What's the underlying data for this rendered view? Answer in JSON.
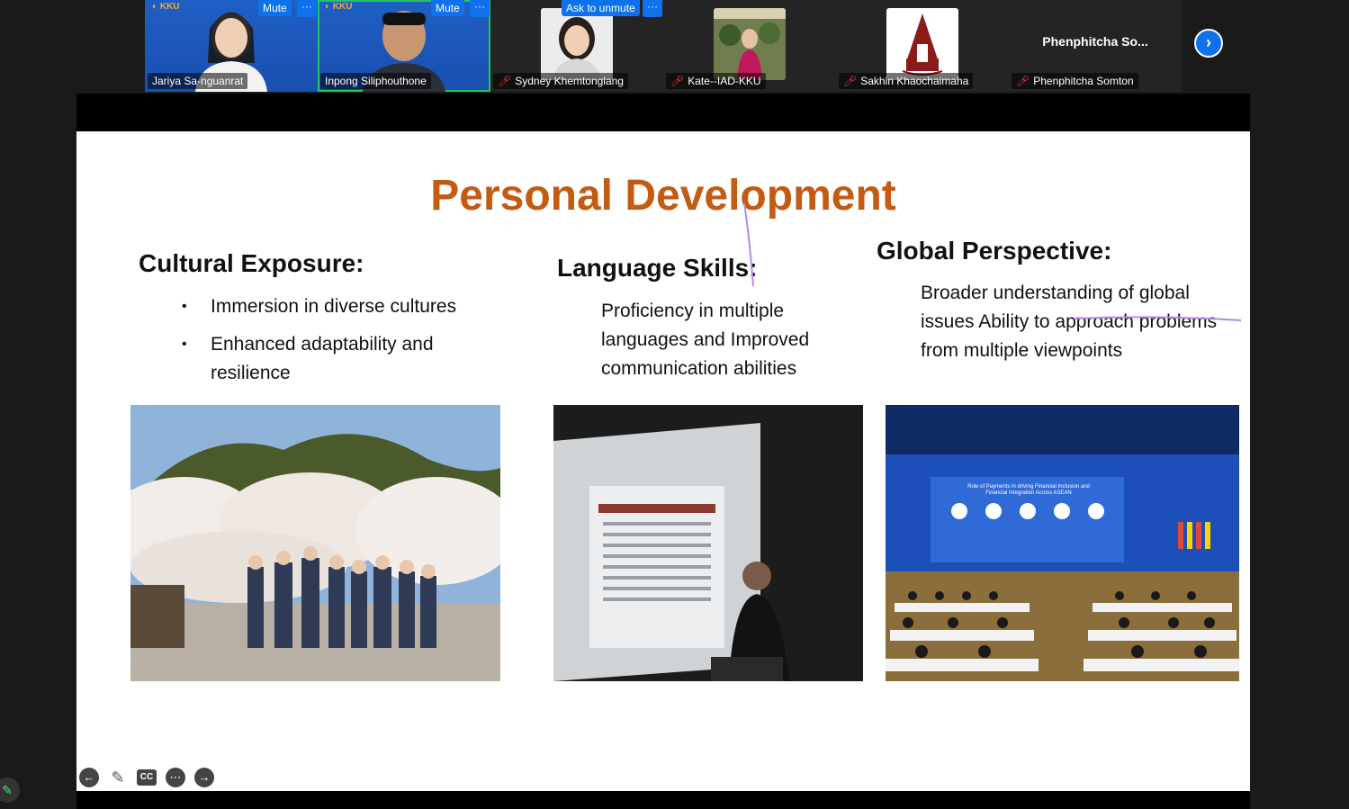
{
  "participants": [
    {
      "name": "Jariya Sa-nguanrat",
      "badge": "Mute",
      "menu": "···",
      "video": true
    },
    {
      "name": "Inpong Siliphouthone",
      "badge": "Mute",
      "menu": "···",
      "video": true
    },
    {
      "name": "Sydney Khemtonglang",
      "badge": "Ask to unmute",
      "menu": "···",
      "muted": true
    },
    {
      "name": "Kate--IAD-KKU",
      "muted": true
    },
    {
      "name": "Sakhin Khaochaimaha",
      "muted": true
    },
    {
      "name": "Phenphitcha Somton",
      "display_name": "Phenphitcha  So...",
      "muted": true
    }
  ],
  "next_icon": "chevron-right-icon",
  "slide": {
    "title": "Personal Development",
    "columns": [
      {
        "heading": "Cultural Exposure:",
        "bullets": [
          "Immersion in diverse cultures",
          "Enhanced adaptability and resilience"
        ]
      },
      {
        "heading": "Language Skills:",
        "text": "Proficiency in multiple languages and Improved communication abilities"
      },
      {
        "heading": "Global Perspective:",
        "text": "Broader understanding of global issues Ability to approach problems from multiple viewpoints"
      }
    ],
    "photo3_banner": "Role of Payments in driving Financial Inclusion and Financial Integration Across ASEAN"
  },
  "toolbar": {
    "cc": "CC",
    "icons": [
      "arrow-left-icon",
      "pen-icon",
      "cc-icon",
      "more-icon",
      "arrow-right-icon"
    ]
  },
  "colors": {
    "title": "#c55a11",
    "accent": "#0e72ed",
    "active_border": "#22c55e"
  }
}
